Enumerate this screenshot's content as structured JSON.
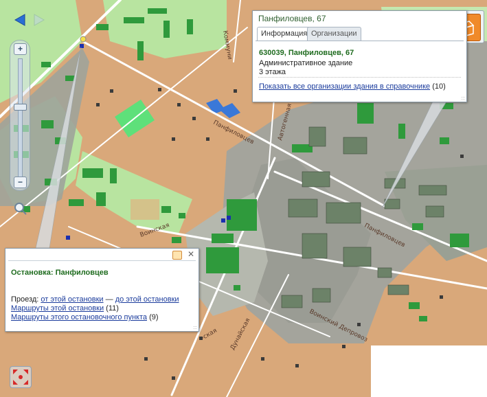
{
  "map": {
    "streets": [
      {
        "id": "panfilovtsev-1",
        "label": "Панфиловцев"
      },
      {
        "id": "panfilovtsev-2",
        "label": "Панфиловцев"
      },
      {
        "id": "voinskaya-1",
        "label": "Воинская"
      },
      {
        "id": "voinskaya-2",
        "label": "Воинский Депровоз"
      },
      {
        "id": "avtogennaya",
        "label": "Автогенная"
      },
      {
        "id": "kommunisticheskaya",
        "label": "Коммуни"
      },
      {
        "id": "dunaiskaya",
        "label": "Дунайская"
      },
      {
        "id": "bottom-left",
        "label": "-ская"
      }
    ],
    "colors": {
      "residential": "#d9a87a",
      "greenzone": "#b8e4a0",
      "industrial": "#a4a49c",
      "building_green": "#2f9a3c",
      "building_dark": "#5b7b58",
      "road": "#ffffff",
      "selected_building": "#3a78d8"
    }
  },
  "nav": {
    "back_icon": "arrow-left-icon",
    "forward_icon": "arrow-right-icon",
    "zoom_in": "+",
    "zoom_out": "−"
  },
  "info_popup": {
    "title": "Панфиловцев, 67",
    "tabs": [
      {
        "label": "Информация"
      },
      {
        "label": "Организации"
      }
    ],
    "address": "630039, Панфиловцев, 67",
    "building_type": "Административное здание",
    "floors": "3 этажа",
    "orgs_link": "Показать все организации здания в справочнике",
    "orgs_count": "(10)"
  },
  "stop_popup": {
    "title": "Остановка: Панфиловцев",
    "route_label": "Проезд:",
    "from_link": "от этой остановки",
    "dash": "—",
    "to_link": "до этой остановки",
    "routes_stop_link": "Маршруты этой остановки",
    "routes_stop_count": "(11)",
    "routes_point_link": "Маршруты этого остановочного пункта",
    "routes_point_count": "(9)"
  },
  "tools": [
    {
      "name": "ruler-icon"
    },
    {
      "name": "radar-icon"
    },
    {
      "name": "3d-view-icon"
    }
  ]
}
